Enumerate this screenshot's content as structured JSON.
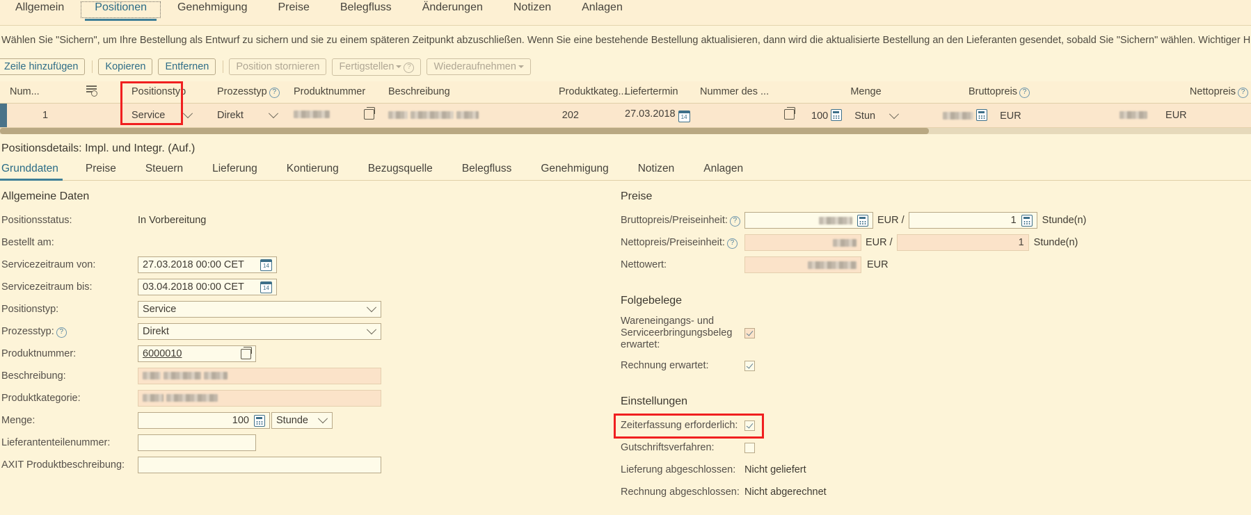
{
  "top_tabs": [
    {
      "label": "Allgemein",
      "active": false
    },
    {
      "label": "Positionen",
      "active": true
    },
    {
      "label": "Genehmigung",
      "active": false
    },
    {
      "label": "Preise",
      "active": false
    },
    {
      "label": "Belegfluss",
      "active": false
    },
    {
      "label": "Änderungen",
      "active": false
    },
    {
      "label": "Notizen",
      "active": false
    },
    {
      "label": "Anlagen",
      "active": false
    }
  ],
  "instructions": "Wählen Sie \"Sichern\", um Ihre Bestellung als Entwurf zu sichern und sie zu einem späteren Zeitpunkt abzuschließen. Wenn Sie eine bestehende Bestellung aktualisieren, dann wird die aktualisierte Bestellung an den Lieferanten gesendet, sobald Sie \"Sichern\" wählen. Wichtiger Hinweis: O...",
  "toolbar": {
    "add_row": "Zeile hinzufügen",
    "copy": "Kopieren",
    "remove": "Entfernen",
    "cancel_position": "Position stornieren",
    "complete": "Fertigstellen",
    "resume": "Wiederaufnehmen"
  },
  "items_table": {
    "columns": [
      "Num...",
      "",
      "Positionstyp",
      "Prozesstyp",
      "Produktnummer",
      "Beschreibung",
      "Produktkateg...",
      "Liefertermin",
      "Nummer des ...",
      "Menge",
      "Bruttopreis",
      "Nettopreis"
    ],
    "row": {
      "num": "1",
      "positionstyp": "Service",
      "prozesstyp": "Direkt",
      "produktkategorie": "202",
      "liefertermin": "27.03.2018",
      "menge": "100",
      "einheit": "Stun",
      "brutto_currency": "EUR",
      "netto_currency": "EUR"
    }
  },
  "details": {
    "title": "Positionsdetails: Impl. und Integr. (Auf.)",
    "tabs": [
      {
        "label": "Grunddaten",
        "active": true
      },
      {
        "label": "Preise",
        "active": false
      },
      {
        "label": "Steuern",
        "active": false
      },
      {
        "label": "Lieferung",
        "active": false
      },
      {
        "label": "Kontierung",
        "active": false
      },
      {
        "label": "Bezugsquelle",
        "active": false
      },
      {
        "label": "Belegfluss",
        "active": false
      },
      {
        "label": "Genehmigung",
        "active": false
      },
      {
        "label": "Notizen",
        "active": false
      },
      {
        "label": "Anlagen",
        "active": false
      }
    ],
    "left": {
      "heading": "Allgemeine Daten",
      "positionsstatus_label": "Positionsstatus:",
      "positionsstatus_value": "In Vorbereitung",
      "bestellt_am_label": "Bestellt am:",
      "bestellt_am_value": "",
      "service_von_label": "Servicezeitraum von:",
      "service_von_value": "27.03.2018 00:00 CET",
      "service_bis_label": "Servicezeitraum bis:",
      "service_bis_value": "03.04.2018 00:00 CET",
      "positionstyp_label": "Positionstyp:",
      "positionstyp_value": "Service",
      "prozesstyp_label": "Prozesstyp:",
      "prozesstyp_value": "Direkt",
      "produktnummer_label": "Produktnummer:",
      "produktnummer_value": "6000010",
      "beschreibung_label": "Beschreibung:",
      "produktkategorie_label": "Produktkategorie:",
      "menge_label": "Menge:",
      "menge_value": "100",
      "menge_einheit": "Stunde",
      "lieferantenteilenummer_label": "Lieferantenteilenummer:",
      "lieferantenteilenummer_value": "",
      "axit_label": "AXIT Produktbeschreibung:",
      "axit_value": ""
    },
    "right": {
      "preise_heading": "Preise",
      "bruttopreis_label": "Bruttopreis/Preiseinheit:",
      "bruttopreis_currency": "EUR /",
      "bruttopreis_unit_value": "1",
      "bruttopreis_unit": "Stunde(n)",
      "nettopreis_label": "Nettopreis/Preiseinheit:",
      "nettopreis_currency": "EUR /",
      "nettopreis_unit_value": "1",
      "nettopreis_unit": "Stunde(n)",
      "nettowert_label": "Nettowert:",
      "nettowert_currency": "EUR",
      "folgebelege_heading": "Folgebelege",
      "wareneingang_label": "Wareneingangs- und Serviceerbringungsbeleg erwartet:",
      "wareneingang_checked": true,
      "rechnung_label": "Rechnung erwartet:",
      "rechnung_checked": true,
      "einstellungen_heading": "Einstellungen",
      "zeiterfassung_label": "Zeiterfassung erforderlich:",
      "zeiterfassung_checked": true,
      "gutschrift_label": "Gutschriftsverfahren:",
      "gutschrift_checked": false,
      "lieferung_abg_label": "Lieferung abgeschlossen:",
      "lieferung_abg_value": "Nicht geliefert",
      "rechnung_abg_label": "Rechnung abgeschlossen:",
      "rechnung_abg_value": "Nicht abgerechnet"
    }
  },
  "colors": {
    "page_bg": "#fdf4d8",
    "header_bg": "#fdf0d3",
    "row_bg": "#fbe7cc",
    "accent": "#3f7f97",
    "highlight": "#f01f1f"
  }
}
